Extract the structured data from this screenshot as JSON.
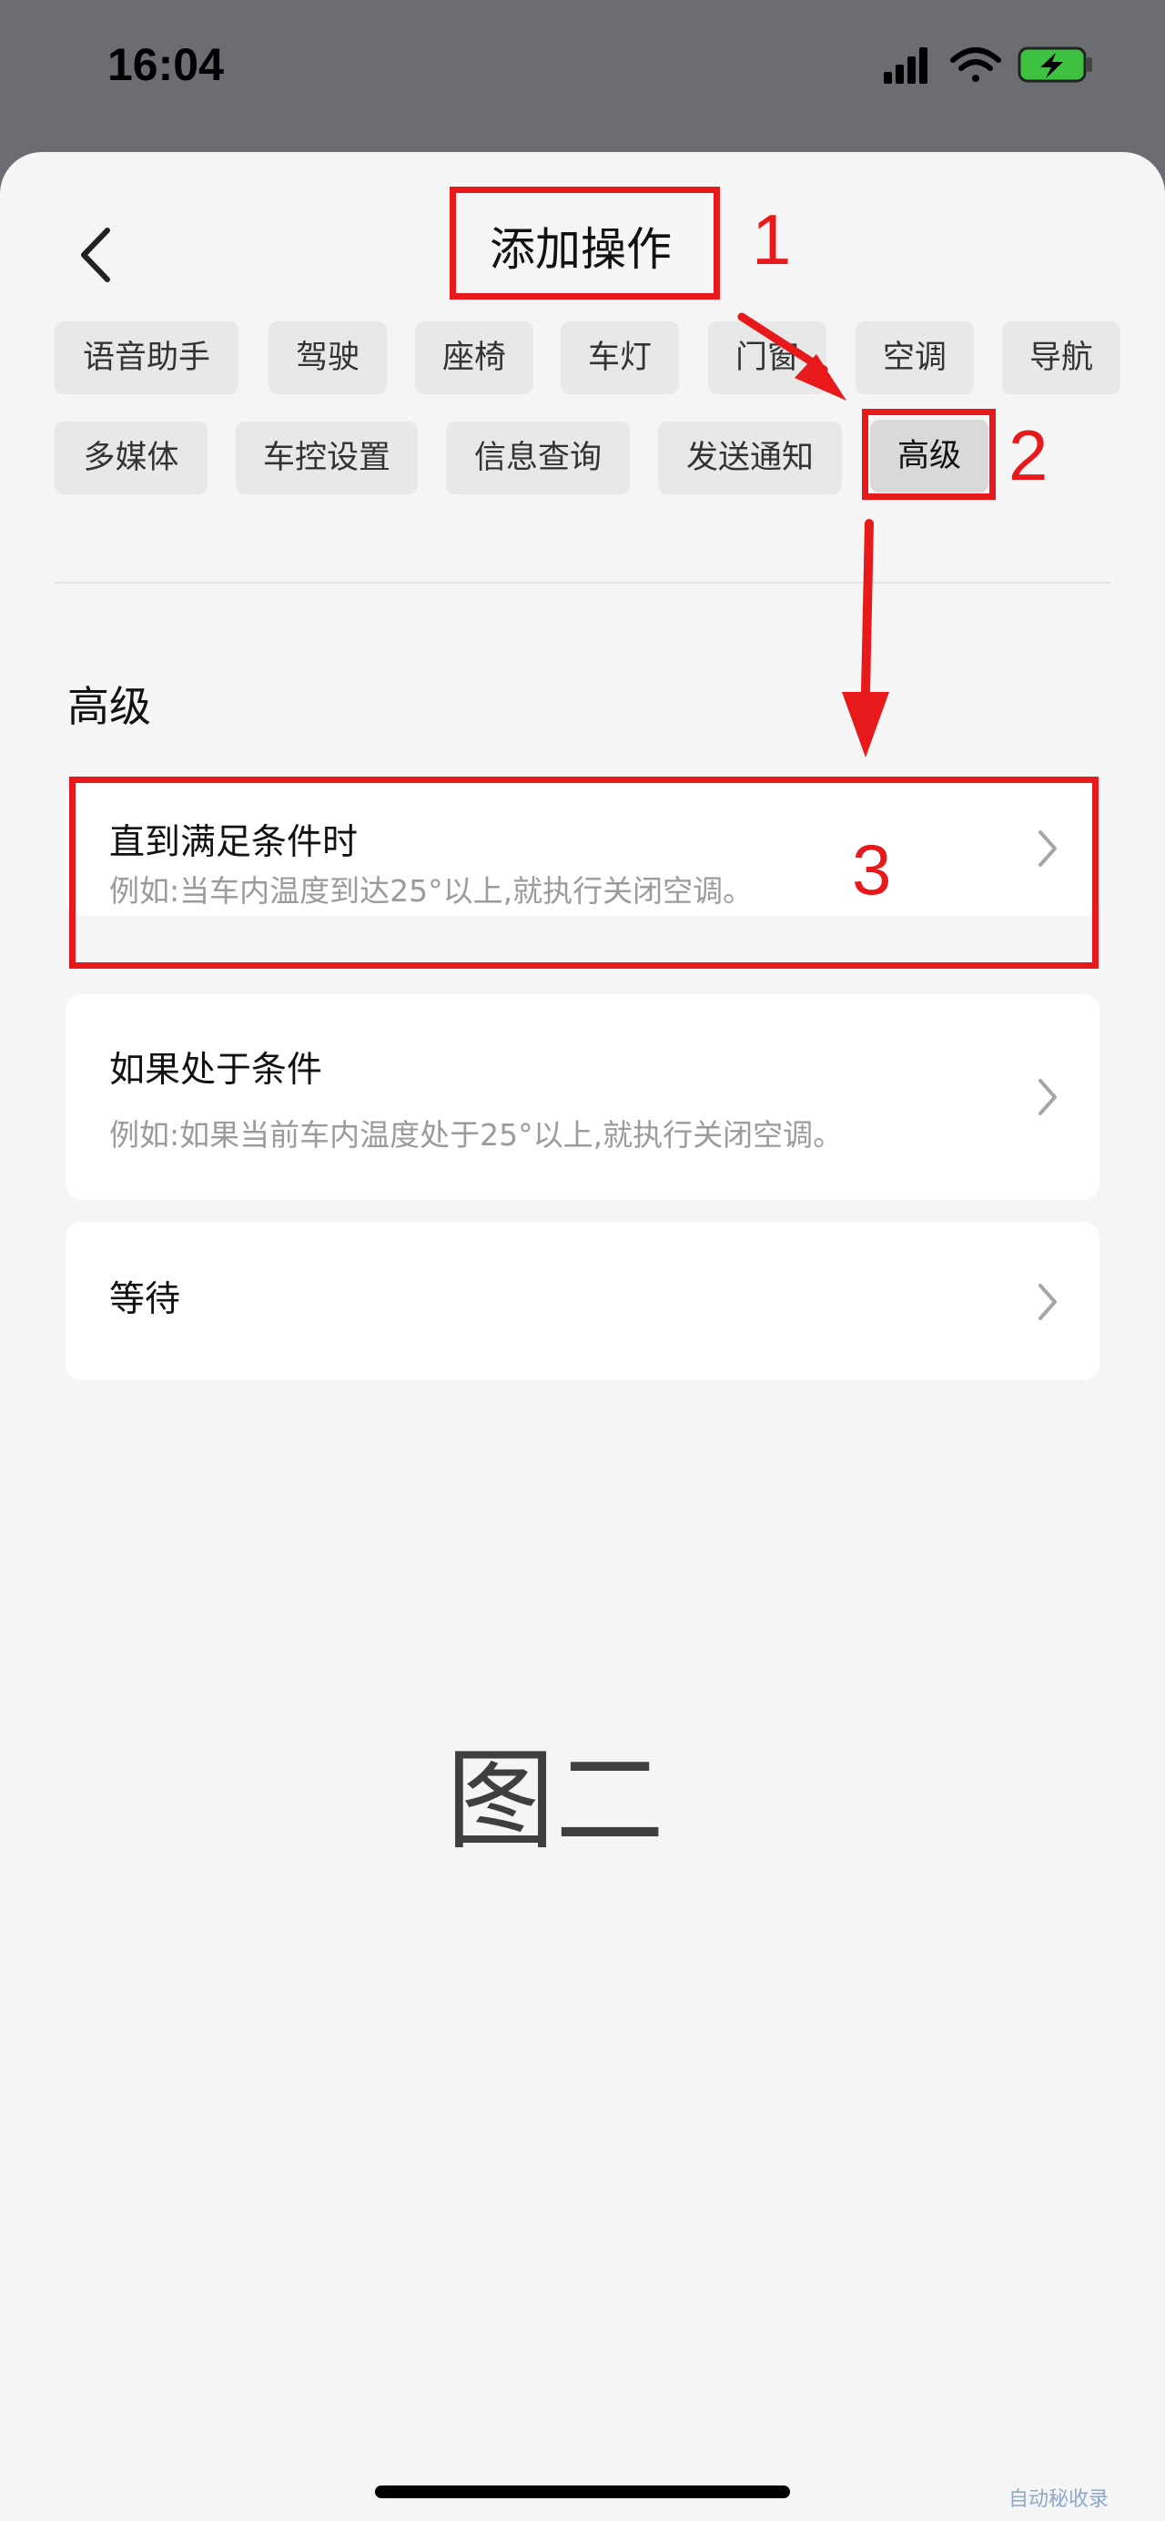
{
  "status_bar": {
    "time": "16:04"
  },
  "header": {
    "title": "添加操作"
  },
  "chips": [
    "语音助手",
    "驾驶",
    "座椅",
    "车灯",
    "门窗",
    "空调",
    "导航",
    "多媒体",
    "车控设置",
    "信息查询",
    "发送通知",
    "高级"
  ],
  "selected_chip": "高级",
  "section": {
    "heading": "高级"
  },
  "cards": [
    {
      "title": "直到满足条件时",
      "desc": "例如:当车内温度到达25°以上,就执行关闭空调。"
    },
    {
      "title": "如果处于条件",
      "desc": "例如:如果当前车内温度处于25°以上,就执行关闭空调。"
    },
    {
      "title": "等待"
    }
  ],
  "annotations": [
    "1",
    "2",
    "3"
  ],
  "caption": "图二",
  "watermark": "自动秘收录",
  "colors": {
    "annotation": "#e8191b",
    "background": "#f5f5f5",
    "status_bar": "#6b6d72"
  }
}
